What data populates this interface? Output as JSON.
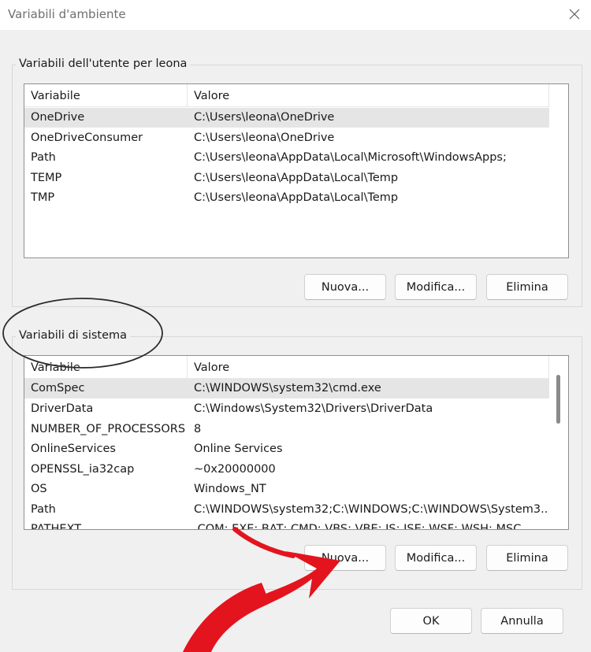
{
  "window": {
    "title": "Variabili d'ambiente"
  },
  "user_vars": {
    "group_label": "Variabili dell'utente per leona",
    "columns": [
      "Variabile",
      "Valore"
    ],
    "rows": [
      {
        "name": "OneDrive",
        "value": "C:\\Users\\leona\\OneDrive"
      },
      {
        "name": "OneDriveConsumer",
        "value": "C:\\Users\\leona\\OneDrive"
      },
      {
        "name": "Path",
        "value": "C:\\Users\\leona\\AppData\\Local\\Microsoft\\WindowsApps;"
      },
      {
        "name": "TEMP",
        "value": "C:\\Users\\leona\\AppData\\Local\\Temp"
      },
      {
        "name": "TMP",
        "value": "C:\\Users\\leona\\AppData\\Local\\Temp"
      }
    ],
    "buttons": {
      "new": "Nuova...",
      "edit": "Modifica...",
      "delete": "Elimina"
    }
  },
  "system_vars": {
    "group_label": "Variabili di sistema",
    "columns": [
      "Variabile",
      "Valore"
    ],
    "rows": [
      {
        "name": "ComSpec",
        "value": "C:\\WINDOWS\\system32\\cmd.exe"
      },
      {
        "name": "DriverData",
        "value": "C:\\Windows\\System32\\Drivers\\DriverData"
      },
      {
        "name": "NUMBER_OF_PROCESSORS",
        "value": "8"
      },
      {
        "name": "OnlineServices",
        "value": "Online Services"
      },
      {
        "name": "OPENSSL_ia32cap",
        "value": "~0x20000000"
      },
      {
        "name": "OS",
        "value": "Windows_NT"
      },
      {
        "name": "Path",
        "value": "C:\\WINDOWS\\system32;C:\\WINDOWS;C:\\WINDOWS\\System3..."
      },
      {
        "name": "PATHEXT",
        "value": ".COM;.EXE;.BAT;.CMD;.VBS;.VBE;.JS;.JSE;.WSF;.WSH;.MSC"
      }
    ],
    "buttons": {
      "new": "Nuova...",
      "edit": "Modifica...",
      "delete": "Elimina"
    }
  },
  "footer": {
    "ok": "OK",
    "cancel": "Annulla"
  },
  "annotations": {
    "circle_color": "#2b2b2b",
    "arrow_color": "#e3141d"
  }
}
